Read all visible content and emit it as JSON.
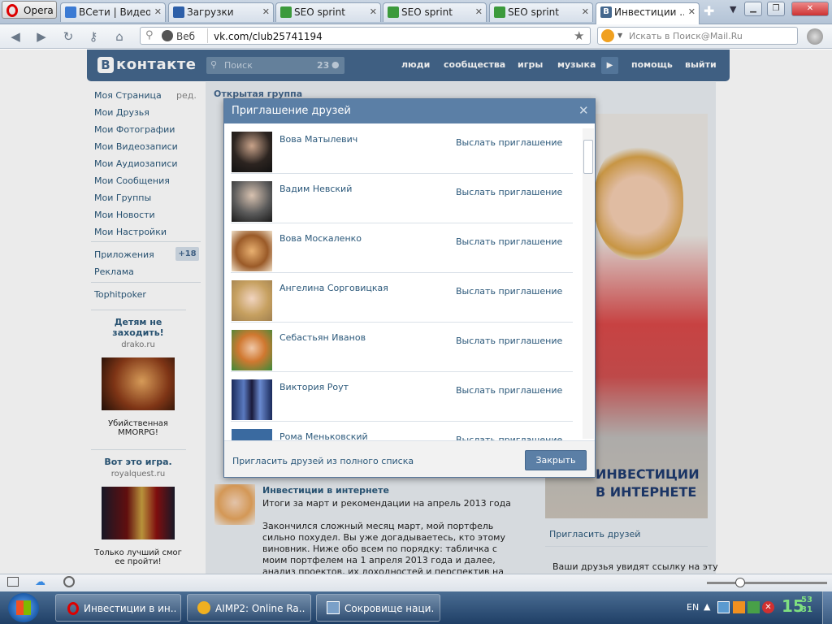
{
  "browser": {
    "opera_label": "Opera",
    "tabs": [
      {
        "label": "ВСети | Видео"
      },
      {
        "label": "Загрузки"
      },
      {
        "label": "SEO sprint"
      },
      {
        "label": "SEO sprint"
      },
      {
        "label": "SEO sprint"
      },
      {
        "label": "Инвестиции ..."
      }
    ],
    "address_prefix": "Веб",
    "url": "vk.com/club25741194",
    "search_placeholder": "Искать в Поиск@Mail.Ru"
  },
  "vk": {
    "logo": "контакте",
    "search_placeholder": "Поиск",
    "search_count": "23",
    "topmenu": [
      "люди",
      "сообщества",
      "игры",
      "музыка",
      "помощь",
      "выйти"
    ],
    "left_menu": [
      {
        "label": "Моя Страница",
        "extra": "ред."
      },
      {
        "label": "Мои Друзья"
      },
      {
        "label": "Мои Фотографии"
      },
      {
        "label": "Мои Видеозаписи"
      },
      {
        "label": "Мои Аудиозаписи"
      },
      {
        "label": "Мои Сообщения"
      },
      {
        "label": "Мои Группы"
      },
      {
        "label": "Мои Новости"
      },
      {
        "label": "Мои Настройки"
      }
    ],
    "apps_label": "Приложения",
    "apps_badge": "+18",
    "ads_label": "Реклама",
    "tophit_label": "Tophitpoker",
    "ad1": {
      "title": "Детям не заходить!",
      "domain": "drako.ru",
      "caption": "Убийственная MMORPG!"
    },
    "ad2": {
      "title": "Вот это игра.",
      "domain": "royalquest.ru",
      "caption": "Только лучший смог ее пройти!"
    },
    "group_type": "Открытая группа",
    "post": {
      "author": "Инвестиции в интернете",
      "line1": "Итоги за март и рекомендации на апрель 2013 года",
      "body": "Закончился сложный месяц март, мой портфель сильно похудел. Вы уже догадываетесь, кто этому виновник. Ниже обо всем по порядку: табличка с моим портфелем на 1 апреля 2013 года и далее, анализ проектов, их доходностей и перспектив на будущее"
    },
    "banner_text": "ИНВЕСТИЦИИ В ИНТЕРНЕТЕ",
    "invite_link": "Пригласить друзей",
    "invite_note": "Ваши друзья увидят ссылку на эту"
  },
  "modal": {
    "title": "Приглашение друзей",
    "invite_label": "Выслать приглашение",
    "friends": [
      {
        "name": "Вова Матылевич"
      },
      {
        "name": "Вадим Невский"
      },
      {
        "name": "Вова Москаленко"
      },
      {
        "name": "Ангелина Сорговицкая"
      },
      {
        "name": "Себастьян Иванов"
      },
      {
        "name": "Виктория Роут"
      },
      {
        "name": "Рома Меньковский"
      }
    ],
    "full_list_link": "Пригласить друзей из полного списка",
    "close_button": "Закрыть"
  },
  "taskbar": {
    "items": [
      {
        "label": "Инвестиции в ин..."
      },
      {
        "label": "AIMP2: Online Ra..."
      },
      {
        "label": "Сокровище наци..."
      }
    ],
    "lang": "EN",
    "clock_h": "15",
    "clock_m": "53",
    "clock_s": "31"
  }
}
